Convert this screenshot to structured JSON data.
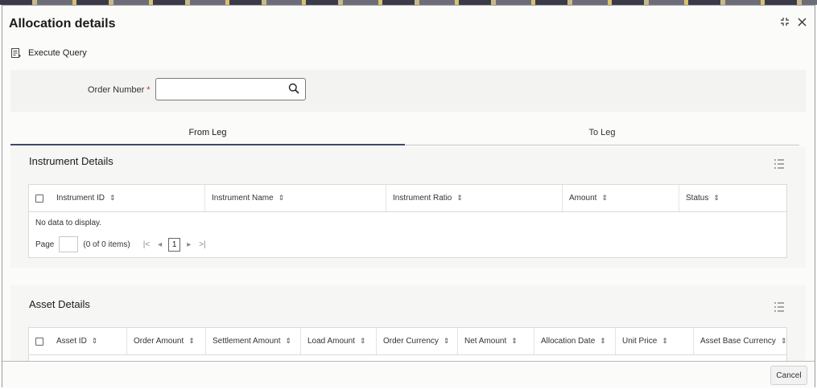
{
  "window": {
    "title": "Allocation details",
    "maximize_icon": "maximize-icon",
    "close_icon": "close-icon"
  },
  "toolbar": {
    "execute_query_label": "Execute Query",
    "execute_query_icon": "execute-query-icon"
  },
  "search": {
    "order_number_label": "Order Number",
    "required_marker": "*",
    "order_number_value": "",
    "search_icon": "search-icon"
  },
  "tabs": [
    {
      "label": "From Leg",
      "active": true
    },
    {
      "label": "To Leg",
      "active": false
    }
  ],
  "instrument_details": {
    "title": "Instrument Details",
    "columns": [
      "Instrument ID",
      "Instrument Name",
      "Instrument Ratio",
      "Amount",
      "Status"
    ],
    "empty_message": "No data to display.",
    "pager": {
      "page_label": "Page",
      "items_text": "(0 of 0 items)",
      "first": "|<",
      "prev": "◂",
      "current_page": "1",
      "next": "▸",
      "last": ">|"
    }
  },
  "asset_details": {
    "title": "Asset Details",
    "columns": [
      "Asset ID",
      "Order Amount",
      "Settlement Amount",
      "Load Amount",
      "Order Currency",
      "Net Amount",
      "Allocation Date",
      "Unit Price",
      "Asset Base Currency"
    ]
  },
  "footer": {
    "cancel_label": "Cancel"
  },
  "colors": {
    "accent": "#3d4a63",
    "required": "#c0392b"
  }
}
